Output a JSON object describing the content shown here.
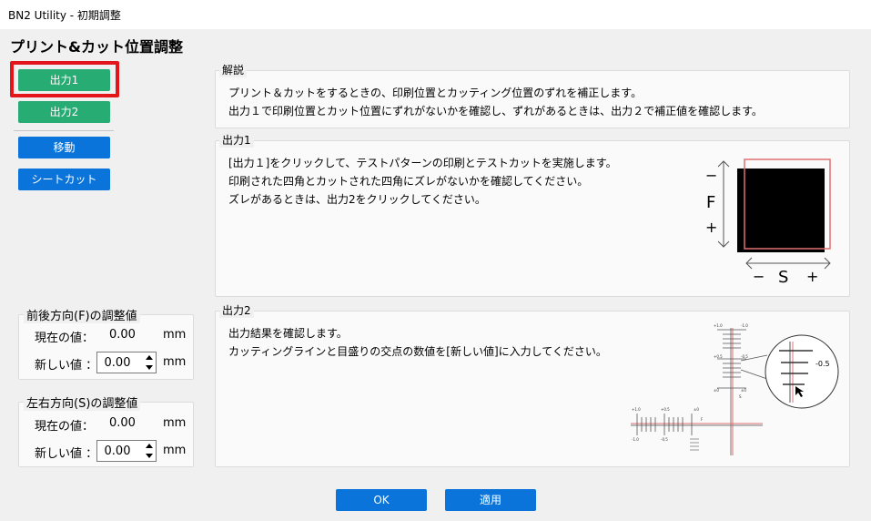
{
  "window": {
    "title": "BN2 Utility - 初期調整"
  },
  "page": {
    "heading": "プリント&カット位置調整"
  },
  "buttons": {
    "output1": "出力1",
    "output2": "出力2",
    "move": "移動",
    "sheet_cut": "シートカット",
    "ok": "OK",
    "apply": "適用"
  },
  "sections": {
    "explanation": {
      "title": "解説",
      "lines": [
        "プリント＆カットをするときの、印刷位置とカッティング位置のずれを補正します。",
        "出力１で印刷位置とカット位置にずれがないかを確認し、ずれがあるときは、出力２で補正値を確認します。"
      ]
    },
    "output1": {
      "title": "出力1",
      "lines": [
        "[出力１]をクリックして、テストパターンの印刷とテストカットを実施します。",
        "印刷された四角とカットされた四角にズレがないかを確認してください。",
        "ズレがあるときは、出力2をクリックしてください。"
      ],
      "diagram": {
        "minus": "−",
        "plus": "+",
        "f": "F",
        "s": "S"
      }
    },
    "output2": {
      "title": "出力2",
      "lines": [
        "出力結果を確認します。",
        "カッティングラインと目盛りの交点の数値を[新しい値]に入力してください。"
      ],
      "diagram": {
        "zoom_value": "-0.5",
        "f": "F",
        "s": "S",
        "ticks_vertical": [
          "+1.0",
          "-1.0",
          "+0.5",
          "-0.5",
          "±0",
          "±0",
          "-0.5",
          "+0.5"
        ],
        "ticks_horizontal": [
          "+1.0",
          "+0.5",
          "±0",
          "-1.0",
          "-0.5"
        ]
      }
    }
  },
  "adjust_f": {
    "title": "前後方向(F)の調整値",
    "current_label": "現在の値：",
    "current_value": "0.00",
    "current_unit": "mm",
    "new_label": "新しい値 ：",
    "new_value": "0.00",
    "new_unit": "mm"
  },
  "adjust_s": {
    "title": "左右方向(S)の調整値",
    "current_label": "現在の値：",
    "current_value": "0.00",
    "current_unit": "mm",
    "new_label": "新しい値 ：",
    "new_value": "0.00",
    "new_unit": "mm"
  },
  "colors": {
    "accent_blue": "#0a74da",
    "accent_green": "#27ad74",
    "highlight_red": "#e3161b",
    "cut_line": "#e07070"
  }
}
